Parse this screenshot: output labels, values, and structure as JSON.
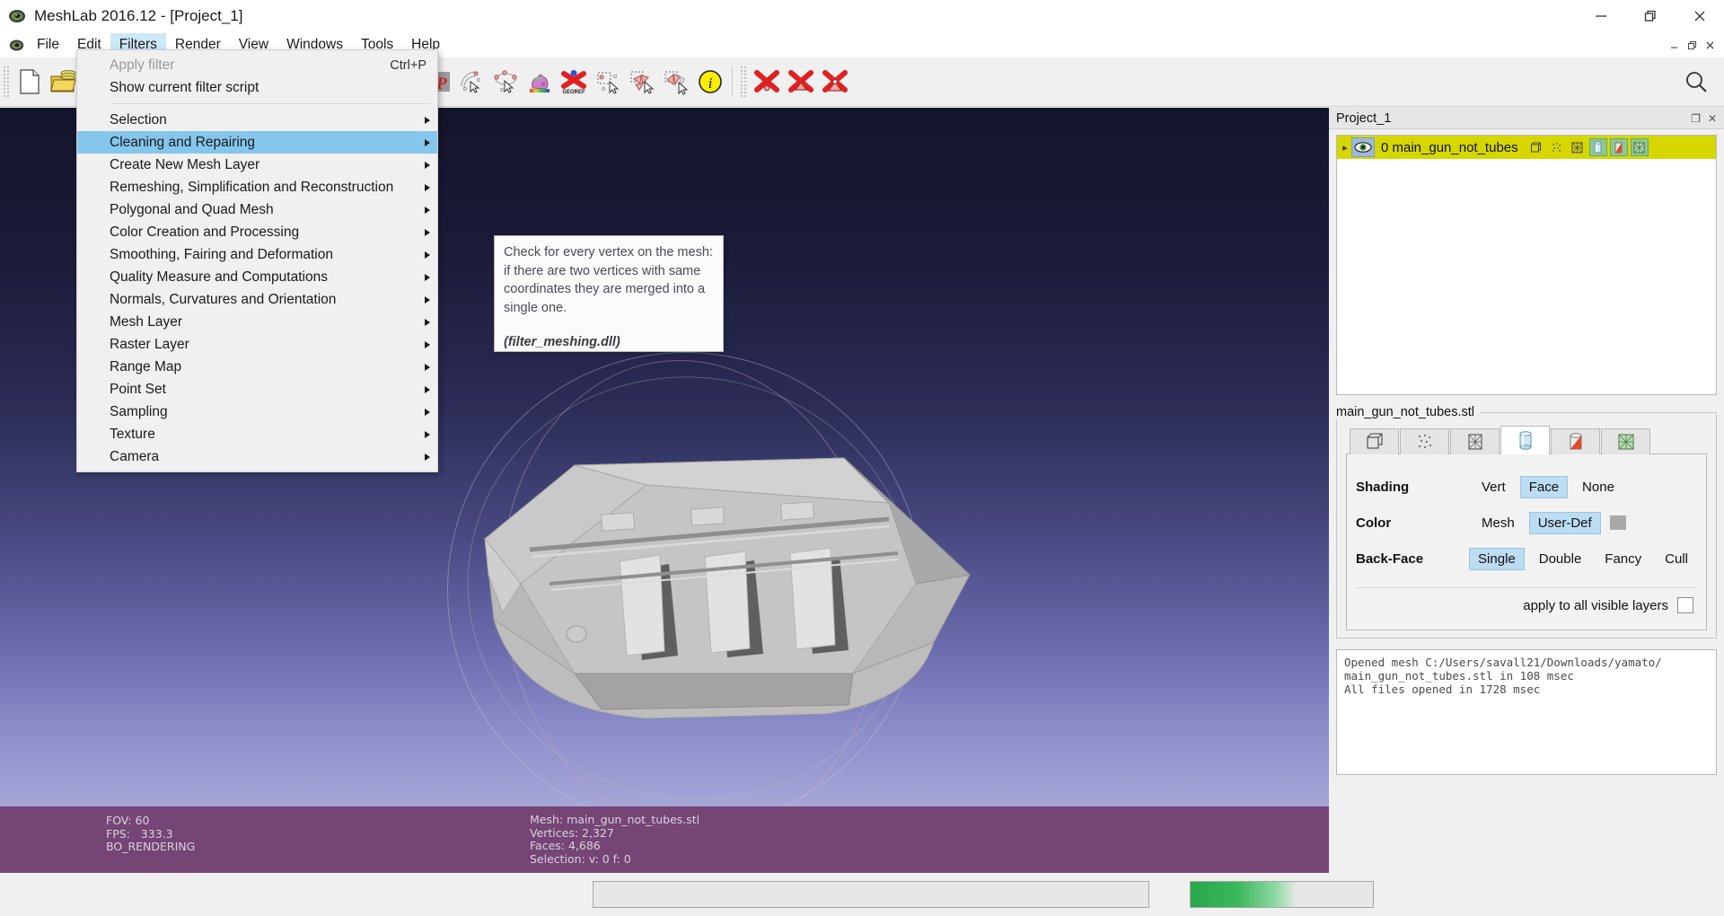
{
  "window": {
    "title": "MeshLab 2016.12 - [Project_1]",
    "app_icon": "meshlab-logo-icon",
    "controls": {
      "minimize": "—",
      "restore": "❐",
      "close": "✕"
    },
    "mdi_controls": {
      "minimize": "_",
      "restore": "❐",
      "close": "✕"
    }
  },
  "menubar": {
    "items": [
      {
        "label": "File",
        "name": "menu-file",
        "active": false
      },
      {
        "label": "Edit",
        "name": "menu-edit",
        "active": false
      },
      {
        "label": "Filters",
        "name": "menu-filters",
        "active": true
      },
      {
        "label": "Render",
        "name": "menu-render",
        "active": false
      },
      {
        "label": "View",
        "name": "menu-view",
        "active": false
      },
      {
        "label": "Windows",
        "name": "menu-windows",
        "active": false
      },
      {
        "label": "Tools",
        "name": "menu-tools",
        "active": false
      },
      {
        "label": "Help",
        "name": "menu-help",
        "active": false
      }
    ]
  },
  "filters_menu": {
    "apply_filter": {
      "label": "Apply filter",
      "shortcut": "Ctrl+P",
      "disabled": true
    },
    "show_script": {
      "label": "Show current filter script"
    },
    "submenus": [
      {
        "label": "Selection",
        "selected": false
      },
      {
        "label": "Cleaning and Repairing",
        "selected": true
      },
      {
        "label": "Create New Mesh Layer",
        "selected": false
      },
      {
        "label": "Remeshing, Simplification and Reconstruction",
        "selected": false
      },
      {
        "label": "Polygonal and Quad Mesh",
        "selected": false
      },
      {
        "label": "Color Creation and Processing",
        "selected": false
      },
      {
        "label": "Smoothing, Fairing and Deformation",
        "selected": false
      },
      {
        "label": "Quality Measure and Computations",
        "selected": false
      },
      {
        "label": "Normals, Curvatures and Orientation",
        "selected": false
      },
      {
        "label": "Mesh Layer",
        "selected": false
      },
      {
        "label": "Raster Layer",
        "selected": false
      },
      {
        "label": "Range Map",
        "selected": false
      },
      {
        "label": "Point Set",
        "selected": false
      },
      {
        "label": "Sampling",
        "selected": false
      },
      {
        "label": "Texture",
        "selected": false
      },
      {
        "label": "Camera",
        "selected": false
      }
    ]
  },
  "tooltip": {
    "body": "Check for every vertex on the mesh: if there are two vertices with same coordinates they are merged into a single one.",
    "dll": "(filter_meshing.dll)"
  },
  "toolbar": {
    "groups": [
      {
        "buttons": [
          {
            "name": "new-project-icon",
            "title": "New Project"
          },
          {
            "name": "open-project-icon",
            "title": "Open Project"
          }
        ]
      },
      {
        "buttons": [
          {
            "name": "point-cloud-icon",
            "title": "Show Layer Dialog"
          },
          {
            "name": "axis-xyz-icon",
            "title": "Show Axis"
          }
        ]
      },
      {
        "buttons": [
          {
            "name": "globe-wireframe-icon",
            "title": "Sphere"
          },
          {
            "name": "letter-a-yellow-icon",
            "title": "Text"
          },
          {
            "name": "monument-image-icon",
            "title": "Raster"
          },
          {
            "name": "trackball-axes-icon",
            "title": "Trackball"
          },
          {
            "name": "measure-tape-icon",
            "title": "Measuring Tool"
          },
          {
            "name": "raster-alignment-camera-icon",
            "title": "Raster Alignment"
          },
          {
            "name": "paint-brush-icon",
            "title": "Z-Painting"
          },
          {
            "name": "pp-points-icon",
            "title": "PickPoints"
          },
          {
            "name": "select-vertices-pointer-icon",
            "title": "Select Vertices"
          },
          {
            "name": "select-connected-pointer-icon",
            "title": "Select Connected Components"
          },
          {
            "name": "colorize-bunny-icon",
            "title": "Colorize"
          },
          {
            "name": "georeference-icon",
            "title": "GeoRef"
          },
          {
            "name": "rect-select-vertices-icon",
            "title": "Rectangle Select Vertices"
          },
          {
            "name": "select-faces-icon",
            "title": "Select Faces"
          },
          {
            "name": "select-faces-alt-icon",
            "title": "Select Faces Alt"
          },
          {
            "name": "info-icon",
            "title": "Info"
          }
        ]
      },
      {
        "buttons": [
          {
            "name": "delete-vertices-icon",
            "title": "Delete Selected Vertices"
          },
          {
            "name": "delete-faces-icon",
            "title": "Delete Selected Faces"
          },
          {
            "name": "delete-faces-vertices-icon",
            "title": "Delete Selected Faces and Vertices"
          }
        ]
      }
    ],
    "search": {
      "name": "search-icon",
      "placeholder": ""
    }
  },
  "viewport": {
    "status_left": "FOV: 60\nFPS:   333.3\nBO_RENDERING",
    "status_mid": "Mesh: main_gun_not_tubes.stl\nVertices: 2,327\nFaces: 4,686\nSelection: v: 0 f: 0",
    "fov": "60",
    "fps": "333.3",
    "render_mode": "BO_RENDERING",
    "mesh_name": "main_gun_not_tubes.stl",
    "vertices": "2,327",
    "faces": "4,686",
    "selection": "v: 0 f: 0"
  },
  "dock": {
    "title": "Project_1",
    "float_icon": "❐",
    "close_icon": "✕",
    "layers": [
      {
        "index": "0",
        "label": "0 main_gun_not_tubes",
        "visible": true,
        "eye_icon": "eye-icon",
        "icons": [
          {
            "name": "bbox-icon",
            "on": false
          },
          {
            "name": "points-icon",
            "on": false
          },
          {
            "name": "wireframe-icon",
            "on": false
          },
          {
            "name": "flat-shading-icon",
            "on": true
          },
          {
            "name": "smooth-shading-icon",
            "on": true
          },
          {
            "name": "texture-icon",
            "on": true
          }
        ]
      }
    ],
    "render_group": {
      "legend": "main_gun_not_tubes.stl",
      "tabs": [
        {
          "name": "tab-bbox",
          "icon": "cube-wire-icon",
          "selected": false
        },
        {
          "name": "tab-points",
          "icon": "dots-icon",
          "selected": false
        },
        {
          "name": "tab-wireframe",
          "icon": "wireframe-cube-icon",
          "selected": false
        },
        {
          "name": "tab-flat",
          "icon": "cylinder-blue-icon",
          "selected": true
        },
        {
          "name": "tab-smooth",
          "icon": "cylinder-red-icon",
          "selected": false
        },
        {
          "name": "tab-texture",
          "icon": "texture-green-icon",
          "selected": false
        }
      ],
      "rows": [
        {
          "label": "Shading",
          "options": [
            {
              "label": "Vert",
              "selected": false
            },
            {
              "label": "Face",
              "selected": true
            },
            {
              "label": "None",
              "selected": false
            }
          ]
        },
        {
          "label": "Color",
          "options": [
            {
              "label": "Mesh",
              "selected": false
            },
            {
              "label": "User-Def",
              "selected": true
            }
          ],
          "swatch": "#a8a8a8"
        },
        {
          "label": "Back-Face",
          "options": [
            {
              "label": "Single",
              "selected": true
            },
            {
              "label": "Double",
              "selected": false
            },
            {
              "label": "Fancy",
              "selected": false
            },
            {
              "label": "Cull",
              "selected": false
            }
          ]
        }
      ],
      "footer_label": "apply to all visible layers",
      "footer_checked": false
    },
    "log": "Opened mesh C:/Users/savall21/Downloads/yamato/\nmain_gun_not_tubes.stl in 108 msec\nAll files opened in 1728 msec"
  },
  "statusbar": {
    "message": "",
    "progress_percent": 58
  },
  "colors": {
    "menu_highlight": "#85c6ec",
    "layer_row": "#d7d700",
    "status_overlay": "#7e4a7e",
    "option_selected": "#bcdcf2",
    "progress": "#27a74a"
  }
}
